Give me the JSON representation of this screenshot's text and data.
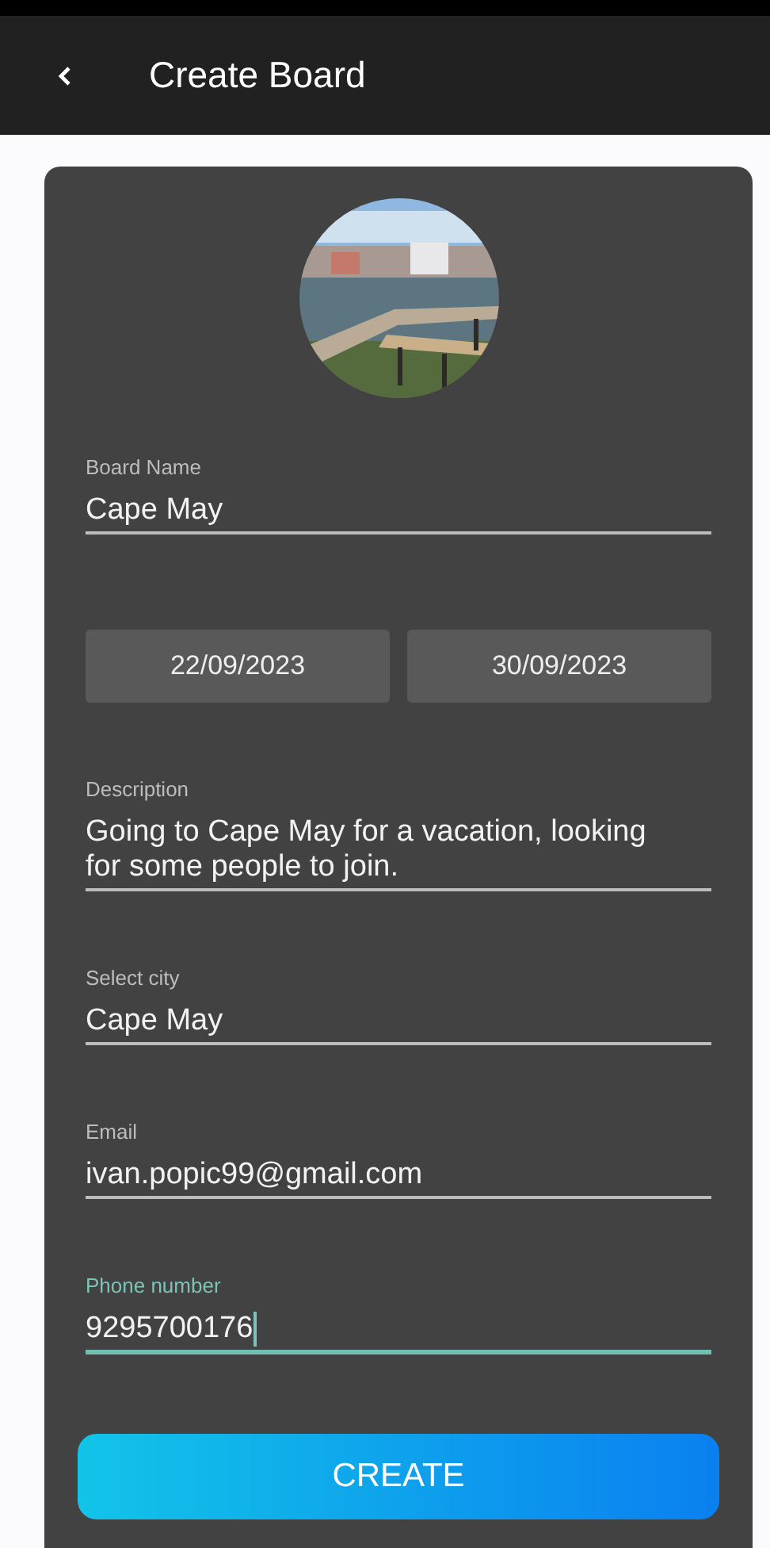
{
  "header": {
    "title": "Create Board"
  },
  "fields_top": [
    {
      "label": "Board Name",
      "value": "Cape May",
      "focused": false
    }
  ],
  "dates": [
    "22/09/2023",
    "30/09/2023"
  ],
  "fields": [
    {
      "label": "Description",
      "value": "Going to Cape May for a vacation, looking for some people to join.",
      "focused": false
    },
    {
      "label": "Select city",
      "value": "Cape May",
      "focused": false
    },
    {
      "label": "Email",
      "value": "ivan.popic99@gmail.com",
      "focused": false
    },
    {
      "label": "Phone number",
      "value": "9295700176",
      "focused": true
    }
  ],
  "create_button": "CREATE"
}
